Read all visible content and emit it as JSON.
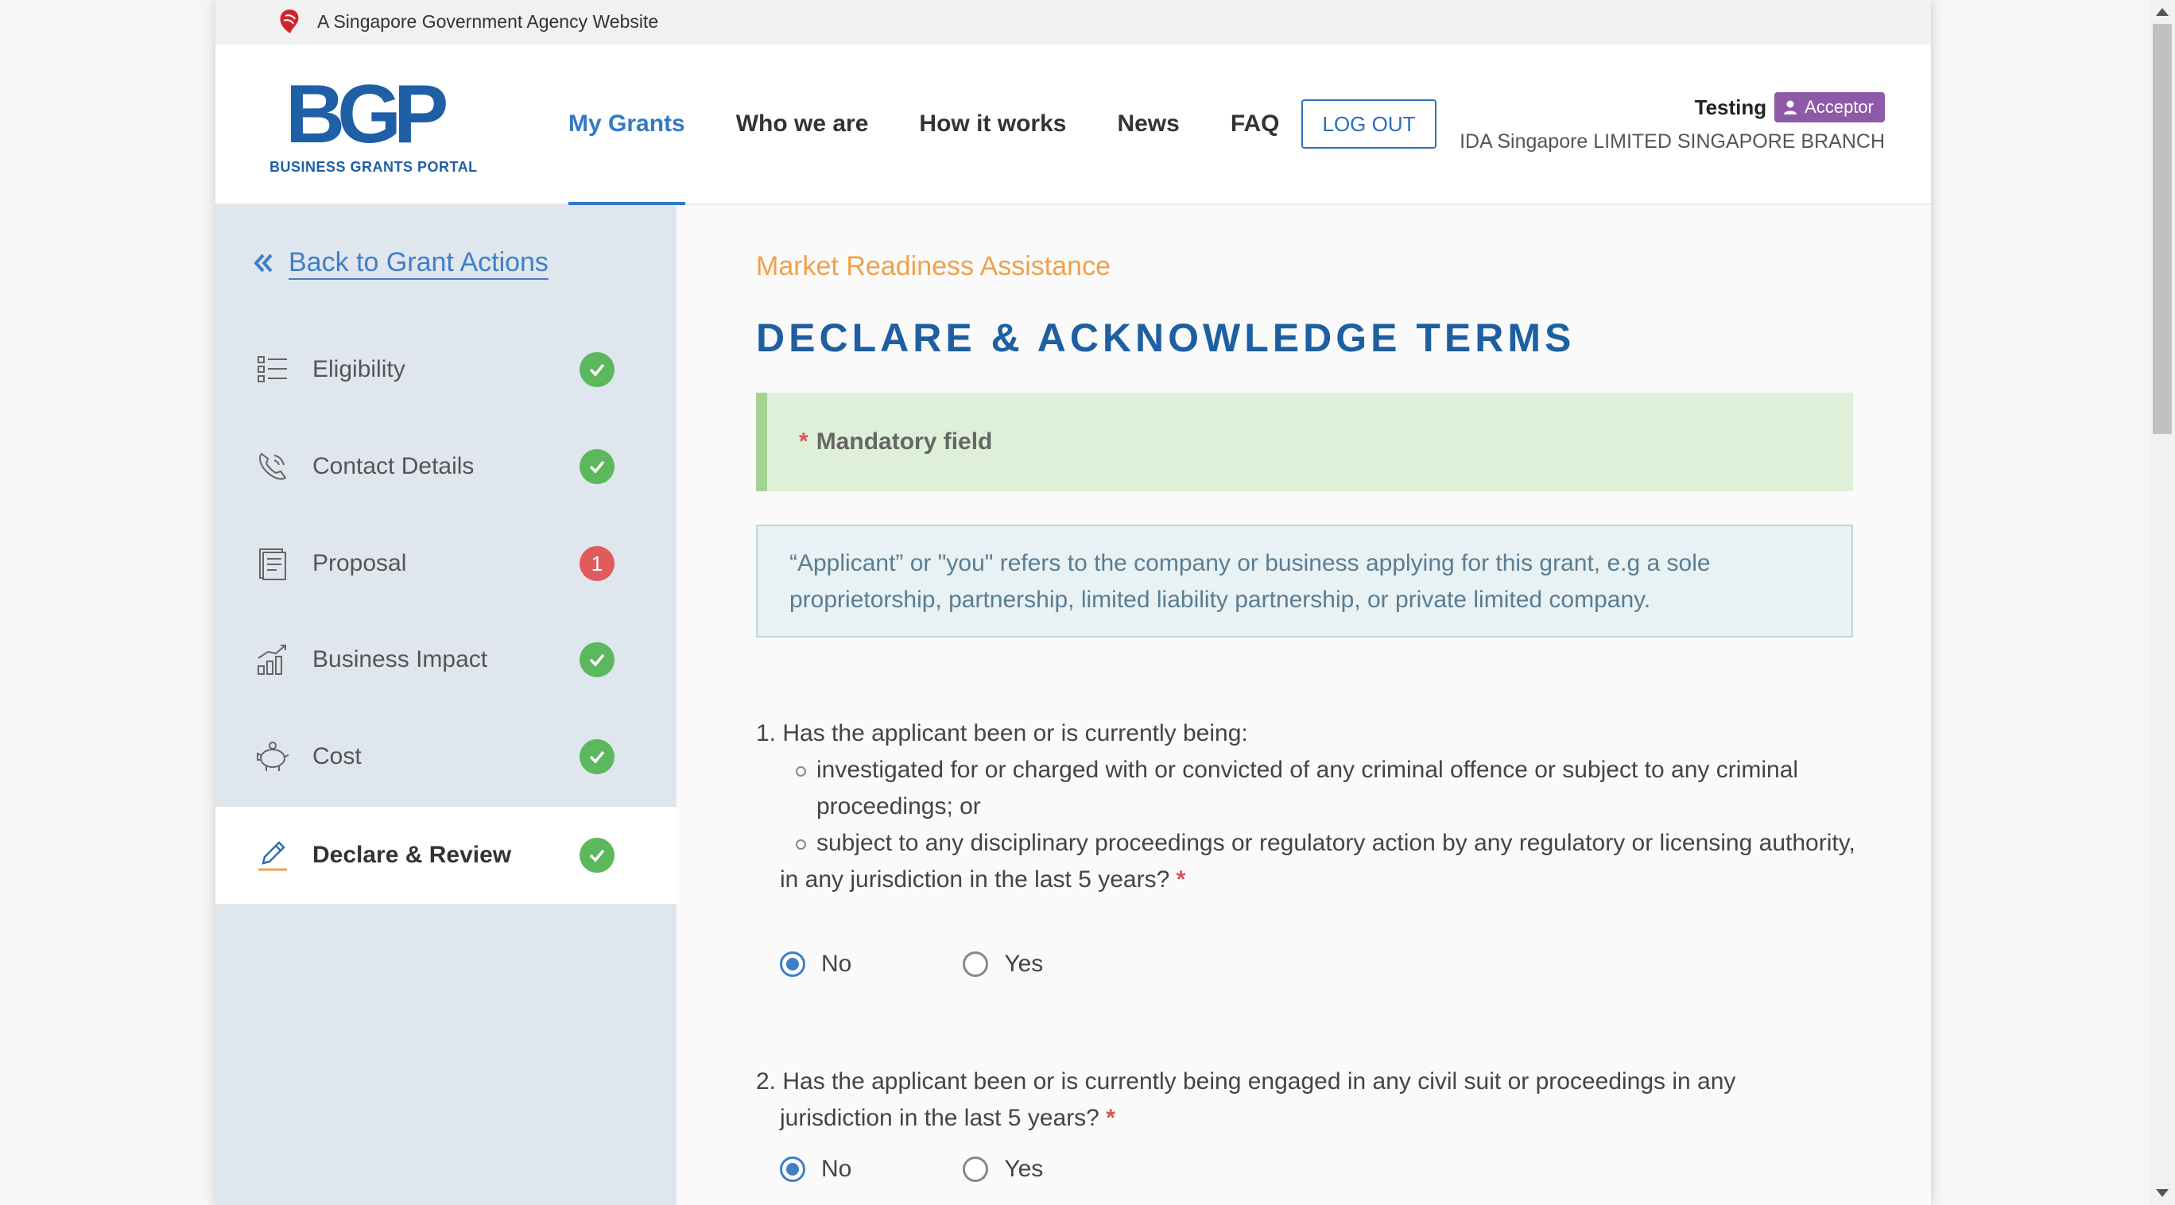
{
  "masthead": {
    "text": "A Singapore Government Agency Website"
  },
  "logo": {
    "mark": "BGP",
    "subtitle": "BUSINESS GRANTS PORTAL"
  },
  "nav": {
    "items": [
      {
        "label": "My Grants",
        "active": true
      },
      {
        "label": "Who we are"
      },
      {
        "label": "How it works"
      },
      {
        "label": "News"
      },
      {
        "label": "FAQ"
      }
    ],
    "logout_label": "LOG OUT"
  },
  "user": {
    "name": "Testing",
    "role": "Acceptor",
    "company": "IDA Singapore LIMITED SINGAPORE BRANCH"
  },
  "sidebar": {
    "back_label": "Back to Grant Actions",
    "items": [
      {
        "label": "Eligibility",
        "icon": "list-icon",
        "status": "complete"
      },
      {
        "label": "Contact Details",
        "icon": "phone-icon",
        "status": "complete"
      },
      {
        "label": "Proposal",
        "icon": "document-icon",
        "status": "error",
        "count": "1"
      },
      {
        "label": "Business Impact",
        "icon": "chart-icon",
        "status": "complete"
      },
      {
        "label": "Cost",
        "icon": "piggy-bank-icon",
        "status": "complete"
      },
      {
        "label": "Declare & Review",
        "icon": "pen-icon",
        "status": "complete",
        "active": true
      }
    ]
  },
  "main": {
    "subtitle": "Market Readiness Assistance",
    "title": "DECLARE & ACKNOWLEDGE TERMS",
    "mandatory_asterisk": "*",
    "mandatory_label": "Mandatory field",
    "info": "“Applicant” or \"you\" refers to the company or business applying for this grant, e.g a sole proprietorship, partnership, limited liability partnership, or private limited company.",
    "questions": [
      {
        "number": "1.",
        "text": "Has the applicant been or is currently being:",
        "bullets": [
          "investigated for or charged with or convicted of any criminal offence or subject to any criminal proceedings; or",
          "subject to any disciplinary proceedings or regulatory action by any regulatory or licensing authority,"
        ],
        "tail": "in any jurisdiction in the last 5 years?",
        "required": "*",
        "options": [
          "No",
          "Yes"
        ],
        "selected": "No"
      },
      {
        "number": "2.",
        "text": "Has the applicant been or is currently being engaged in any civil suit or proceedings in any",
        "tail": "jurisdiction in the last 5 years?",
        "required": "*",
        "options": [
          "No",
          "Yes"
        ],
        "selected": "No"
      }
    ]
  },
  "colors": {
    "primary": "#1f5fa6",
    "link": "#3f7fc7",
    "accent_orange": "#f0a04b",
    "success": "#5cb85c",
    "error": "#e05b5b",
    "role_badge": "#8e5aa8"
  }
}
